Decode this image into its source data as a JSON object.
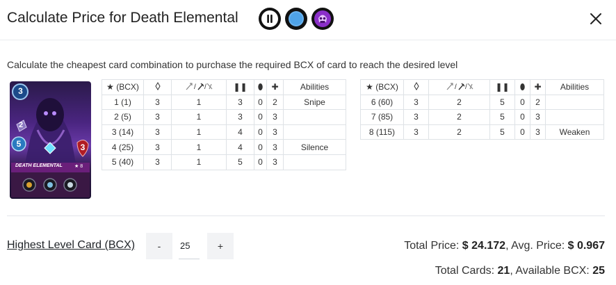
{
  "header": {
    "title": "Calculate Price for Death Elemental",
    "badges": [
      {
        "icon": "pause-icon"
      },
      {
        "icon": "blue-circle-icon"
      },
      {
        "icon": "death-splinter-icon"
      }
    ]
  },
  "description": "Calculate the cheapest card combination to purchase the required BCX of card to reach the desired level",
  "card": {
    "name": "DEATH ELEMENTAL",
    "level": "★ 8",
    "mana": "3",
    "melee": "2",
    "speed": "5",
    "health": "3"
  },
  "table_headers": {
    "level": "(BCX)",
    "abilities": "Abilities"
  },
  "table_left": [
    {
      "level": "1 (1)",
      "mana": "3",
      "attack": "1",
      "speed": "3",
      "armor": "0",
      "health": "2",
      "abilities": "Snipe"
    },
    {
      "level": "2 (5)",
      "mana": "3",
      "attack": "1",
      "speed": "3",
      "armor": "0",
      "health": "3",
      "abilities": ""
    },
    {
      "level": "3 (14)",
      "mana": "3",
      "attack": "1",
      "speed": "4",
      "armor": "0",
      "health": "3",
      "abilities": ""
    },
    {
      "level": "4 (25)",
      "mana": "3",
      "attack": "1",
      "speed": "4",
      "armor": "0",
      "health": "3",
      "abilities": "Silence"
    },
    {
      "level": "5 (40)",
      "mana": "3",
      "attack": "1",
      "speed": "5",
      "armor": "0",
      "health": "3",
      "abilities": ""
    }
  ],
  "table_right": [
    {
      "level": "6 (60)",
      "mana": "3",
      "attack": "2",
      "speed": "5",
      "armor": "0",
      "health": "2",
      "abilities": ""
    },
    {
      "level": "7 (85)",
      "mana": "3",
      "attack": "2",
      "speed": "5",
      "armor": "0",
      "health": "3",
      "abilities": ""
    },
    {
      "level": "8 (115)",
      "mana": "3",
      "attack": "2",
      "speed": "5",
      "armor": "0",
      "health": "3",
      "abilities": "Weaken"
    }
  ],
  "controls": {
    "highest_level_label": "Highest Level Card (BCX)",
    "minus_label": "-",
    "plus_label": "+",
    "bcx_value": "25"
  },
  "summary": {
    "total_price_label": "Total Price: ",
    "total_price": "$ 24.172",
    "avg_price_label": ", Avg. Price: ",
    "avg_price": "$ 0.967",
    "total_cards_label": "Total Cards: ",
    "total_cards": "21",
    "available_bcx_label": ", Available BCX: ",
    "available_bcx": "25"
  },
  "colors": {
    "accent": "#4fa3e8",
    "death_purple": "#8b2fc9"
  }
}
